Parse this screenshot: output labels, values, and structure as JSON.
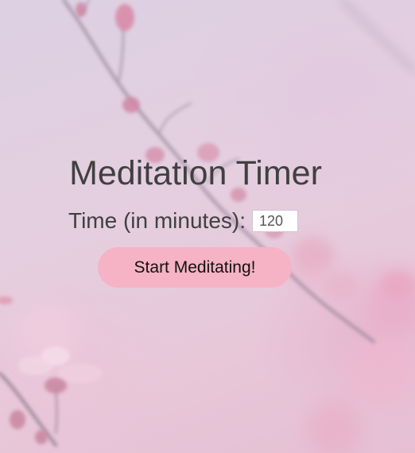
{
  "page": {
    "title": "Meditation Timer"
  },
  "timer": {
    "label": "Time (in minutes):",
    "value": "120"
  },
  "actions": {
    "start_label": "Start Meditating!"
  },
  "colors": {
    "button_background": "#f5b3c5",
    "text": "#404040"
  },
  "background": {
    "image": "blurred cherry blossom branches"
  }
}
